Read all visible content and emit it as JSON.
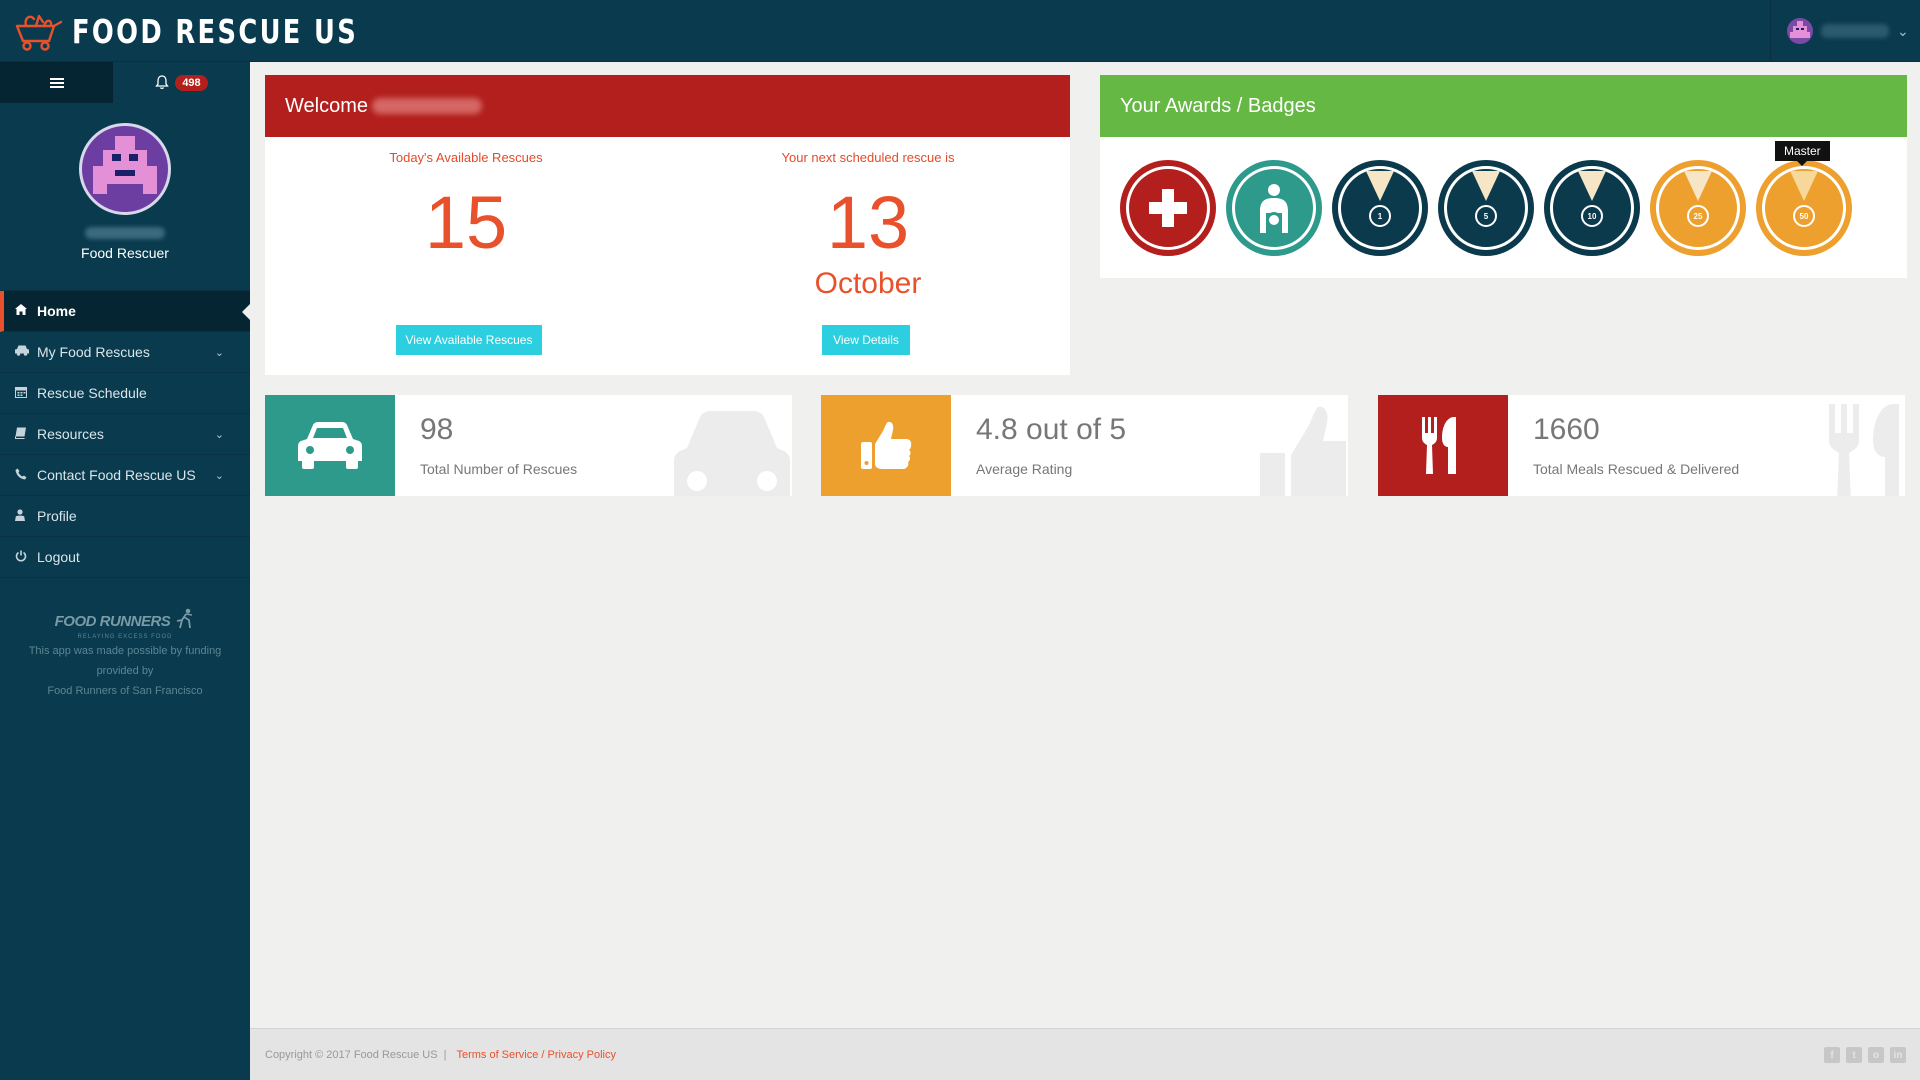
{
  "app": {
    "brand_name": "FOOD RESCUE US"
  },
  "sidebar": {
    "notification_count": "498",
    "profile_role": "Food Rescuer",
    "nav": [
      {
        "label": "Home",
        "icon": "home-icon"
      },
      {
        "label": "My Food Rescues",
        "icon": "car-icon"
      },
      {
        "label": "Rescue Schedule",
        "icon": "calendar-icon"
      },
      {
        "label": "Resources",
        "icon": "book-icon"
      },
      {
        "label": "Contact Food Rescue US",
        "icon": "phone-icon"
      },
      {
        "label": "Profile",
        "icon": "user-icon"
      },
      {
        "label": "Logout",
        "icon": "power-icon"
      }
    ],
    "sponsor": {
      "logo_text": "FOOD RUNNERS",
      "logo_tagline": "RELAYING EXCESS FOOD",
      "line1": "This app was made possible by funding",
      "line2": "provided by",
      "line3": "Food Runners of San Francisco"
    }
  },
  "welcome": {
    "title": "Welcome",
    "available_label": "Today's Available Rescues",
    "available_count": "15",
    "available_button": "View Available Rescues",
    "next_label": "Your next scheduled rescue is",
    "next_day": "13",
    "next_month": "October",
    "next_button": "View Details"
  },
  "awards": {
    "title": "Your Awards / Badges",
    "badges": [
      {
        "name": "first-aid-badge",
        "color": "red",
        "text": ""
      },
      {
        "name": "nurture-badge",
        "color": "teal",
        "text": ""
      },
      {
        "name": "medal-1-badge",
        "color": "navy",
        "text": "1"
      },
      {
        "name": "medal-5-badge",
        "color": "navy",
        "text": "5"
      },
      {
        "name": "medal-10-badge",
        "color": "navy",
        "text": "10"
      },
      {
        "name": "medal-25-badge",
        "color": "orange",
        "text": "25"
      },
      {
        "name": "master-50-badge",
        "color": "orange",
        "text": "50"
      }
    ],
    "tooltip": "Master"
  },
  "stats": [
    {
      "value": "98",
      "label": "Total Number of Rescues",
      "icon": "car-icon",
      "color": "#2d9a8c"
    },
    {
      "value": "4.8 out of 5",
      "label": "Average Rating",
      "icon": "thumbs-up-icon",
      "color": "#eda02d"
    },
    {
      "value": "1660",
      "label": "Total Meals Rescued & Delivered",
      "icon": "utensils-icon",
      "color": "#b21f1c"
    }
  ],
  "footer": {
    "copyright": "Copyright © 2017 Food Rescue US",
    "separator": "|",
    "link": "Terms of Service / Privacy Policy"
  },
  "colors": {
    "navy": "#093a4d",
    "red": "#b21f1c",
    "green": "#66b845",
    "accent": "#e8512b",
    "cyan": "#2bcfdf",
    "teal": "#2d9a8c",
    "orange": "#eda02d"
  }
}
